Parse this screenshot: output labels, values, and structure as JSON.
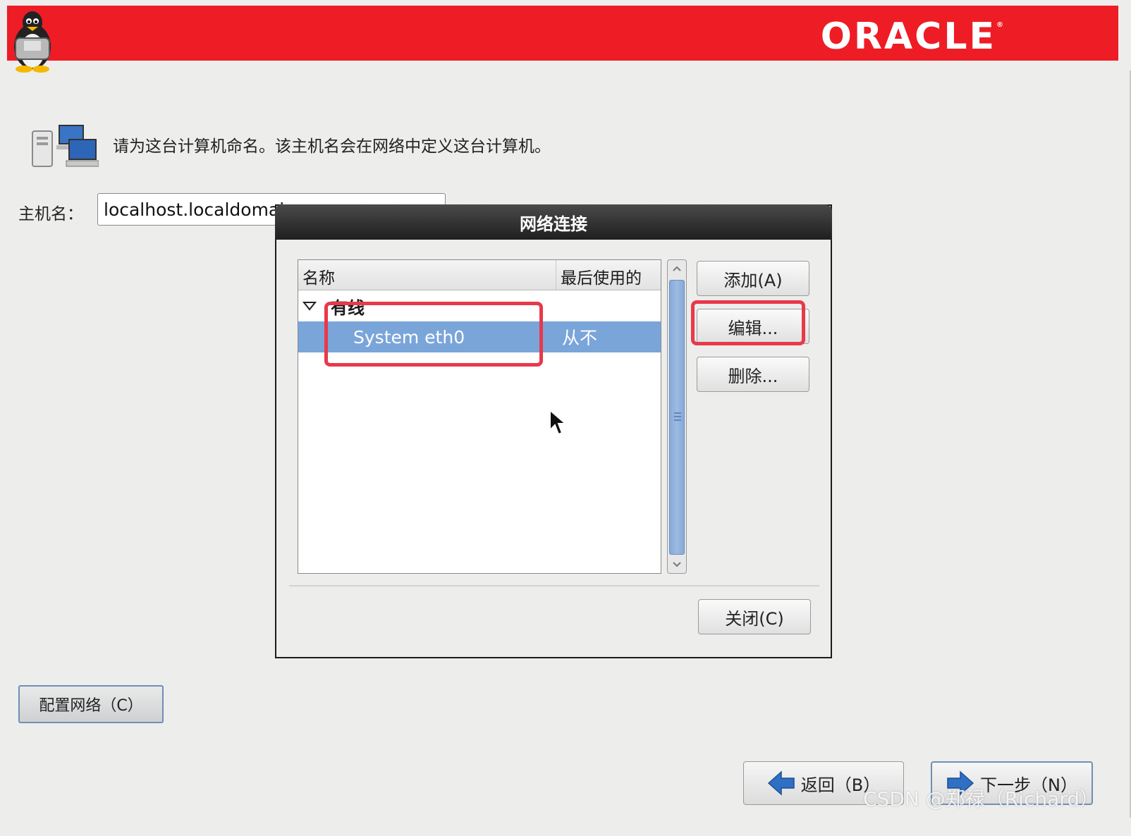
{
  "banner": {
    "brand": "ORACLE"
  },
  "hostname_page": {
    "instruction": "请为这台计算机命名。该主机名会在网络中定义这台计算机。",
    "hostname_label": "主机名：",
    "hostname_value": "localhost.localdomain",
    "configure_network_label": "配置网络（C）",
    "back_label": "返回（B）",
    "next_label": "下一步（N）"
  },
  "dialog": {
    "title": "网络连接",
    "columns": [
      "名称",
      "最后使用的"
    ],
    "group": "有线",
    "connection": {
      "name": "System eth0",
      "last_used": "从不"
    },
    "buttons": {
      "add": "添加(A)",
      "edit": "编辑...",
      "delete": "删除...",
      "close": "关闭(C)"
    }
  },
  "watermark": "CSDN @郑禄（Richard）",
  "colors": {
    "banner": "#ee1c25",
    "selection": "#7aa5d9",
    "highlight": "#e8394a"
  }
}
